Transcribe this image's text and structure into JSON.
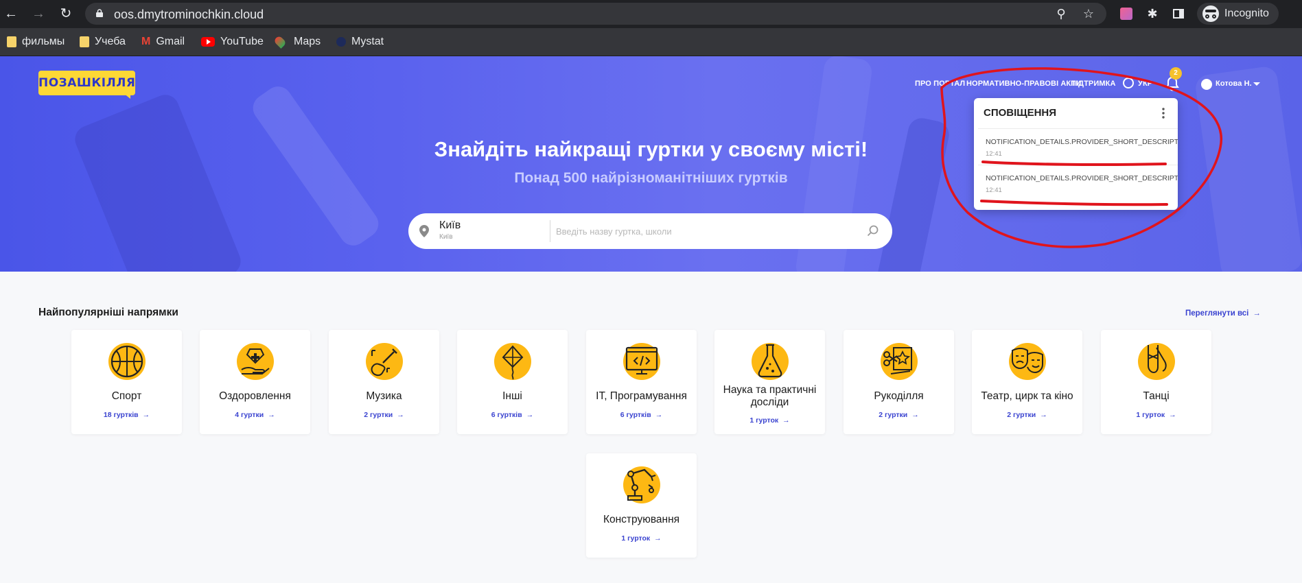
{
  "browser": {
    "url": "oos.dmytrominochkin.cloud",
    "profile_label": "Incognito",
    "bookmarks": [
      "фильмы",
      "Учеба",
      "Gmail",
      "YouTube",
      "Maps",
      "Mystat"
    ]
  },
  "header": {
    "logo_text": "ПОЗАШКІЛЛЯ",
    "nav": [
      "ПРО ПОРТАЛ",
      "НОРМАТИВНО-ПРАВОВІ АКТИ",
      "ПІДТРИМКА"
    ],
    "language": "УКР",
    "notification_count": "2",
    "user_name": "Котова Н."
  },
  "hero": {
    "title": "Знайдіть найкращі гуртки у своєму місті!",
    "subtitle": "Понад 500 найрізноманітніших гуртків"
  },
  "search": {
    "city": "Київ",
    "city_sub": "Київ",
    "placeholder": "Введіть назву гуртка, школи"
  },
  "notifications": {
    "title": "СПОВІЩЕННЯ",
    "items": [
      {
        "text": "NOTIFICATION_DETAILS.PROVIDER_SHORT_DESCRIPTION",
        "time": "12:41"
      },
      {
        "text": "NOTIFICATION_DETAILS.PROVIDER_SHORT_DESCRIPTION",
        "time": "12:41"
      }
    ]
  },
  "categories": {
    "title": "Найпопулярніші напрямки",
    "see_all": "Переглянути всі",
    "items": [
      {
        "title": "Спорт",
        "count": "18 гуртків",
        "icon": "basketball-icon"
      },
      {
        "title": "Оздоровлення",
        "count": "4 гуртки",
        "icon": "health-hand-icon"
      },
      {
        "title": "Музика",
        "count": "2 гуртки",
        "icon": "guitar-icon"
      },
      {
        "title": "Інші",
        "count": "6 гуртків",
        "icon": "kite-icon"
      },
      {
        "title": "ІТ, Програмування",
        "count": "6 гуртків",
        "icon": "computer-code-icon"
      },
      {
        "title": "Наука та практичні досліди",
        "count": "1 гурток",
        "icon": "flask-icon"
      },
      {
        "title": "Рукоділля",
        "count": "2 гуртки",
        "icon": "craft-scissors-icon"
      },
      {
        "title": "Театр, цирк та кіно",
        "count": "2 гуртки",
        "icon": "theater-masks-icon"
      },
      {
        "title": "Танці",
        "count": "1 гурток",
        "icon": "ballet-shoes-icon"
      },
      {
        "title": "Конструювання",
        "count": "1 гурток",
        "icon": "robot-arm-icon"
      }
    ]
  },
  "colors": {
    "accent_blue": "#3a43d0",
    "hero_blue": "#5a62ee",
    "icon_yellow": "#fdb813",
    "annotation_red": "#e0141c"
  }
}
